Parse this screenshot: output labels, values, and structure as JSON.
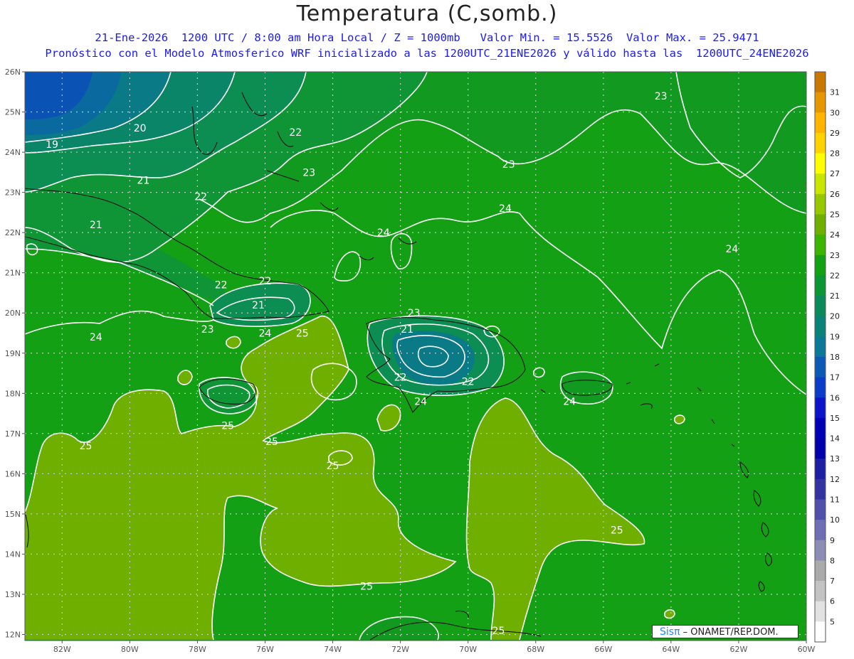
{
  "title": "Temperatura (C,somb.)",
  "subtitle_line1": "21-Ene-2026  1200 UTC / 8:00 am Hora Local / Z = 1000mb   Valor Min. = 15.5526  Valor Max. = 25.9471",
  "subtitle_line2": "Pronóstico con el Modelo Atmosferico WRF inicializado a las 1200UTC_21ENE2026 y válido hasta las  1200UTC_24ENE2026",
  "credit_logo": "Sisπ",
  "credit_text": " – ONAMET/REP.DOM.",
  "lat_labels": [
    "26N",
    "25N",
    "24N",
    "23N",
    "22N",
    "21N",
    "20N",
    "19N",
    "18N",
    "17N",
    "16N",
    "15N",
    "14N",
    "13N",
    "12N"
  ],
  "lon_labels": [
    "82W",
    "80W",
    "78W",
    "76W",
    "74W",
    "72W",
    "70W",
    "68W",
    "66W",
    "64W",
    "62W",
    "60W"
  ],
  "colorbar": {
    "labels": [
      "31",
      "30",
      "29",
      "28",
      "27",
      "26",
      "25",
      "24",
      "23",
      "22",
      "21",
      "20",
      "19",
      "18",
      "17",
      "16",
      "15",
      "14",
      "13",
      "12",
      "11",
      "10",
      "9",
      "8",
      "7",
      "6",
      "5"
    ],
    "colors": [
      "#c87800",
      "#e69600",
      "#ffb400",
      "#ffd200",
      "#ffff00",
      "#c8e600",
      "#96c800",
      "#6eaf00",
      "#3cb400",
      "#14a014",
      "#0a9632",
      "#0a8a5a",
      "#0a8278",
      "#0a7896",
      "#0a5ab4",
      "#0a3cc8",
      "#0a14c8",
      "#0000b4",
      "#0000aa",
      "#1e1ea0",
      "#3232a0",
      "#5050aa",
      "#6e6eb4",
      "#8c8cb4",
      "#aaaaaa",
      "#c3c3c3",
      "#e1e1e1",
      "#ffffff"
    ]
  },
  "contour_labels": [
    {
      "text": "19",
      "lon": -82.3,
      "lat": 24.2
    },
    {
      "text": "20",
      "lon": -79.7,
      "lat": 24.6
    },
    {
      "text": "21",
      "lon": -79.6,
      "lat": 23.3
    },
    {
      "text": "22",
      "lon": -75.1,
      "lat": 24.5
    },
    {
      "text": "23",
      "lon": -74.7,
      "lat": 23.5
    },
    {
      "text": "22",
      "lon": -77.9,
      "lat": 22.9
    },
    {
      "text": "21",
      "lon": -81.0,
      "lat": 22.2
    },
    {
      "text": "23",
      "lon": -64.3,
      "lat": 25.4
    },
    {
      "text": "23",
      "lon": -68.8,
      "lat": 23.7
    },
    {
      "text": "24",
      "lon": -68.9,
      "lat": 22.6
    },
    {
      "text": "24",
      "lon": -72.5,
      "lat": 22.0
    },
    {
      "text": "24",
      "lon": -62.2,
      "lat": 21.6
    },
    {
      "text": "22",
      "lon": -77.3,
      "lat": 20.7
    },
    {
      "text": "22",
      "lon": -76.0,
      "lat": 20.8
    },
    {
      "text": "21",
      "lon": -76.2,
      "lat": 20.2
    },
    {
      "text": "24",
      "lon": -81.0,
      "lat": 19.4
    },
    {
      "text": "23",
      "lon": -77.7,
      "lat": 19.6
    },
    {
      "text": "24",
      "lon": -76.0,
      "lat": 19.5
    },
    {
      "text": "25",
      "lon": -74.9,
      "lat": 19.5
    },
    {
      "text": "23",
      "lon": -71.6,
      "lat": 20.0
    },
    {
      "text": "21",
      "lon": -71.8,
      "lat": 19.6
    },
    {
      "text": "22",
      "lon": -72.0,
      "lat": 18.4
    },
    {
      "text": "22",
      "lon": -70.0,
      "lat": 18.3
    },
    {
      "text": "24",
      "lon": -71.4,
      "lat": 17.8
    },
    {
      "text": "24",
      "lon": -67.0,
      "lat": 17.8
    },
    {
      "text": "25",
      "lon": -77.1,
      "lat": 17.2
    },
    {
      "text": "25",
      "lon": -81.3,
      "lat": 16.7
    },
    {
      "text": "25",
      "lon": -75.8,
      "lat": 16.8
    },
    {
      "text": "25",
      "lon": -74.0,
      "lat": 16.2
    },
    {
      "text": "25",
      "lon": -65.6,
      "lat": 14.6
    },
    {
      "text": "25",
      "lon": -73.0,
      "lat": 13.2
    },
    {
      "text": "25",
      "lon": -69.1,
      "lat": 12.1
    }
  ]
}
